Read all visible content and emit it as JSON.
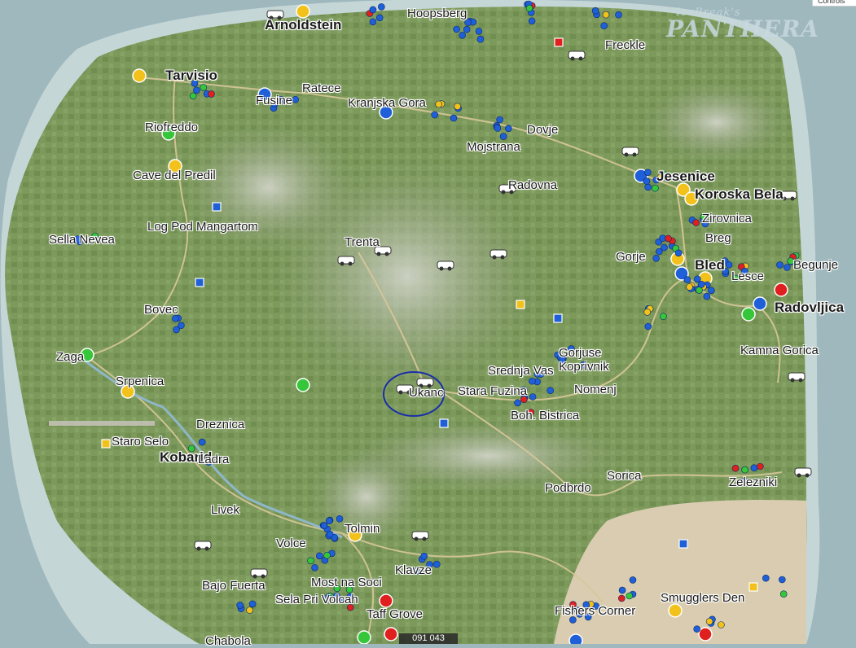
{
  "watermark": {
    "line1": "IceBreak's",
    "line2": "PANTHERA"
  },
  "corner_control_label": "Controls",
  "coordinate_readout": "091 043",
  "places": [
    {
      "name": "Arnoldstein",
      "major": true
    },
    {
      "name": "Hoopsberg",
      "major": false
    },
    {
      "name": "Freckle",
      "major": false
    },
    {
      "name": "Tarvisio",
      "major": true
    },
    {
      "name": "Ratece",
      "major": false
    },
    {
      "name": "Fusine",
      "major": false
    },
    {
      "name": "Kranjska Gora",
      "major": false
    },
    {
      "name": "Riofreddo",
      "major": false
    },
    {
      "name": "Dovje",
      "major": false
    },
    {
      "name": "Mojstrana",
      "major": false
    },
    {
      "name": "Cave del Predil",
      "major": false
    },
    {
      "name": "Jesenice",
      "major": true
    },
    {
      "name": "Radovna",
      "major": false
    },
    {
      "name": "Koroska Bela",
      "major": true
    },
    {
      "name": "Log Pod Mangartom",
      "major": false
    },
    {
      "name": "Zirovnica",
      "major": false
    },
    {
      "name": "Sella Nevea",
      "major": false
    },
    {
      "name": "Trenta",
      "major": false
    },
    {
      "name": "Breg",
      "major": false
    },
    {
      "name": "Gorje",
      "major": false
    },
    {
      "name": "Bled",
      "major": true
    },
    {
      "name": "Begunje",
      "major": false
    },
    {
      "name": "Lesce",
      "major": false
    },
    {
      "name": "Bovec",
      "major": false
    },
    {
      "name": "Radovljica",
      "major": true
    },
    {
      "name": "Zaga",
      "major": false
    },
    {
      "name": "Gorjuse",
      "major": false
    },
    {
      "name": "Kamna Gorica",
      "major": false
    },
    {
      "name": "Srednja Vas",
      "major": false
    },
    {
      "name": "Koprivnik",
      "major": false
    },
    {
      "name": "Srpenica",
      "major": false
    },
    {
      "name": "Ukanc",
      "major": false
    },
    {
      "name": "Stara Fuzina",
      "major": false
    },
    {
      "name": "Nomenj",
      "major": false
    },
    {
      "name": "Boh. Bistrica",
      "major": false
    },
    {
      "name": "Dreznica",
      "major": false
    },
    {
      "name": "Staro Selo",
      "major": false
    },
    {
      "name": "Kobarid",
      "major": true
    },
    {
      "name": "Ladra",
      "major": false
    },
    {
      "name": "Sorica",
      "major": false
    },
    {
      "name": "Zelezniki",
      "major": false
    },
    {
      "name": "Podbrdo",
      "major": false
    },
    {
      "name": "Livek",
      "major": false
    },
    {
      "name": "Tolmin",
      "major": false
    },
    {
      "name": "Volce",
      "major": false
    },
    {
      "name": "Klavze",
      "major": false
    },
    {
      "name": "Bajo Fuerta",
      "major": false
    },
    {
      "name": "Most na Soci",
      "major": false
    },
    {
      "name": "Sela Pri Volcah",
      "major": false
    },
    {
      "name": "Taff Grove",
      "major": false
    },
    {
      "name": "Fishers Corner",
      "major": false
    },
    {
      "name": "Smugglers Den",
      "major": false
    },
    {
      "name": "Chabola",
      "major": false
    }
  ],
  "colors": {
    "sea": "#9fb8be",
    "shallow": "#c5d6d6",
    "land": "#7d9a5c",
    "forest": "#6a8a4a",
    "mountain": "#b9beb0",
    "desert": "#d9ccb0",
    "road": "#d8c79a",
    "marker_blue": "#1f5fd8",
    "marker_yellow": "#f2c21b",
    "marker_green": "#35c63a",
    "marker_red": "#e01f1f",
    "annotation": "#1a2fa8"
  },
  "marker_legend": [
    {
      "type": "blue-marker",
      "color": "#1f5fd8"
    },
    {
      "type": "yellow-marker",
      "color": "#f2c21b"
    },
    {
      "type": "green-marker",
      "color": "#35c63a"
    },
    {
      "type": "red-marker",
      "color": "#e01f1f"
    }
  ]
}
